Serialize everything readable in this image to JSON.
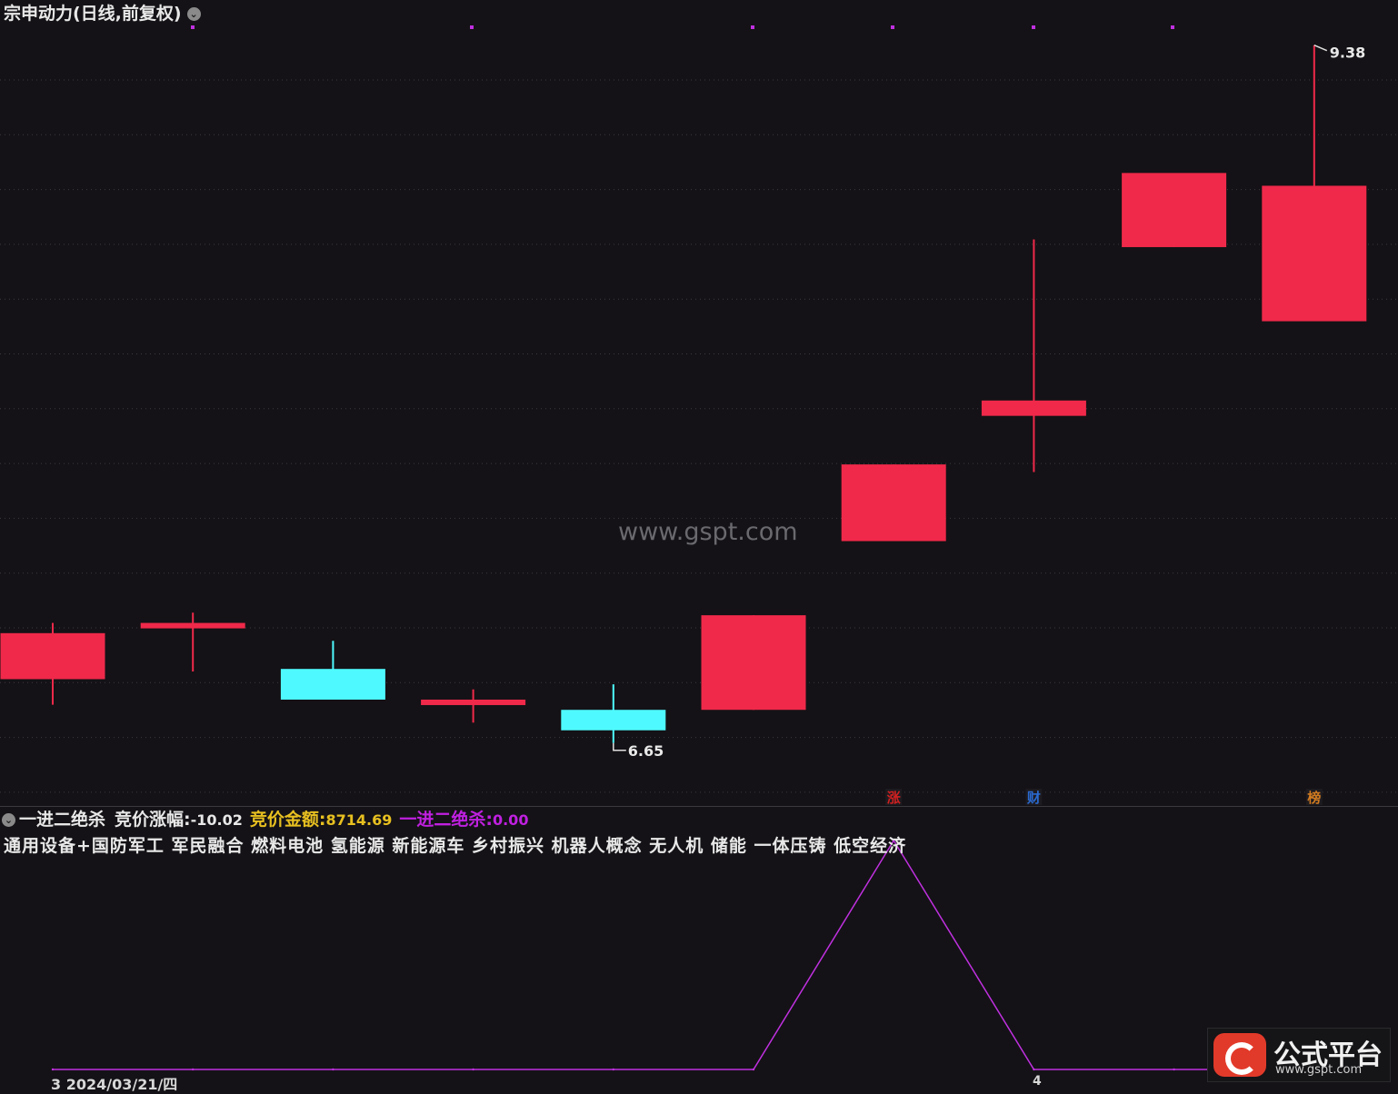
{
  "header": {
    "title": "宗申动力(日线,前复权)",
    "dropdown_icon": "chevron-down-icon"
  },
  "indicator": {
    "name": "一进二绝杀",
    "items": [
      {
        "label": "竞价涨幅:",
        "value": "-10.02",
        "color": "#e8e8e8"
      },
      {
        "label": "竞价金额:",
        "value": "8714.69",
        "color": "#e8c020"
      },
      {
        "label": "一进二绝杀:",
        "value": "0.00",
        "color": "#c020e0"
      }
    ]
  },
  "concepts": "通用设备+国防军工 军民融合 燃料电池 氢能源 新能源车 乡村振兴 机器人概念 无人机 储能 一体压铸 低空经济",
  "watermark": "www.gspt.com",
  "date_label": "3 2024/03/21/四",
  "date_label_2": "4",
  "logo": {
    "title": "公式平台",
    "url": "www.gspt.com"
  },
  "colors": {
    "up": "#f0294a",
    "down": "#4efaff",
    "indicator_line": "#c030e0",
    "background": "#141216"
  },
  "chart_data": [
    {
      "type": "candlestick",
      "ylim": [
        6.5,
        9.45
      ],
      "max_label": "9.38",
      "min_label": "6.65",
      "candles": [
        {
          "open": 6.9,
          "high": 7.12,
          "low": 6.8,
          "close": 7.08,
          "dir": "up"
        },
        {
          "open": 7.1,
          "high": 7.16,
          "low": 6.93,
          "close": 7.12,
          "dir": "up"
        },
        {
          "open": 6.94,
          "high": 7.05,
          "low": 6.86,
          "close": 6.82,
          "dir": "down"
        },
        {
          "open": 6.81,
          "high": 6.86,
          "low": 6.73,
          "close": 6.82,
          "dir": "up"
        },
        {
          "open": 6.78,
          "high": 6.88,
          "low": 6.65,
          "close": 6.7,
          "dir": "down"
        },
        {
          "open": 6.78,
          "high": 7.15,
          "low": 6.78,
          "close": 7.15,
          "dir": "up"
        },
        {
          "open": 7.44,
          "high": 7.74,
          "low": 7.44,
          "close": 7.74,
          "dir": "up"
        },
        {
          "open": 7.93,
          "high": 8.62,
          "low": 7.71,
          "close": 7.99,
          "dir": "up"
        },
        {
          "open": 8.59,
          "high": 8.73,
          "low": 8.59,
          "close": 8.88,
          "dir": "up"
        },
        {
          "open": 8.3,
          "high": 9.38,
          "low": 8.3,
          "close": 8.83,
          "dir": "up"
        }
      ],
      "event_markers": [
        {
          "index": 6,
          "label": "涨",
          "color": "#d02020"
        },
        {
          "index": 7,
          "label": "财",
          "color": "#2a6ad0"
        },
        {
          "index": 9,
          "label": "榜",
          "color": "#d07a20"
        }
      ]
    },
    {
      "type": "line",
      "name": "一进二绝杀",
      "values": [
        0,
        0,
        0,
        0,
        0,
        0,
        1,
        0,
        0,
        0
      ],
      "ylim": [
        0,
        1
      ]
    }
  ]
}
